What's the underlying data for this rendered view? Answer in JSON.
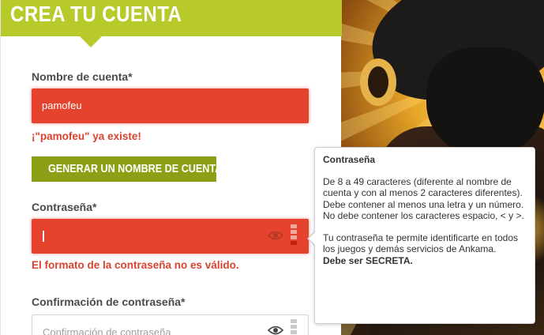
{
  "header": {
    "title": "CREA TU CUENTA"
  },
  "account": {
    "label": "Nombre de cuenta*",
    "value": "pamofeu",
    "error": "¡\"pamofeu\" ya existe!"
  },
  "generate_button": {
    "label": "GENERAR UN NOMBRE DE CUENTA"
  },
  "password": {
    "label": "Contraseña*",
    "value": "•",
    "error": "El formato de la contraseña no es válido.",
    "strength_levels_filled": 1
  },
  "confirm": {
    "label": "Confirmación de contraseña*",
    "placeholder": "Confirmación de contraseña"
  },
  "tooltip": {
    "title": "Contraseña",
    "rules": [
      "De 8 a 49 caracteres (diferente al nombre de cuenta y con al menos 2 caracteres diferentes).",
      "Debe contener al menos una letra y un número.",
      "No debe contener los caracteres espacio, < y >."
    ],
    "info": "Tu contraseña te permite identificarte en todos los juegos y demás servicios de Ankama.",
    "secret": "Debe ser SECRETA."
  },
  "colors": {
    "header": "#b8c92a",
    "button": "#8c9f15",
    "error": "#e5432e"
  },
  "icons": [
    "eye-icon",
    "strength-meter-icon"
  ]
}
